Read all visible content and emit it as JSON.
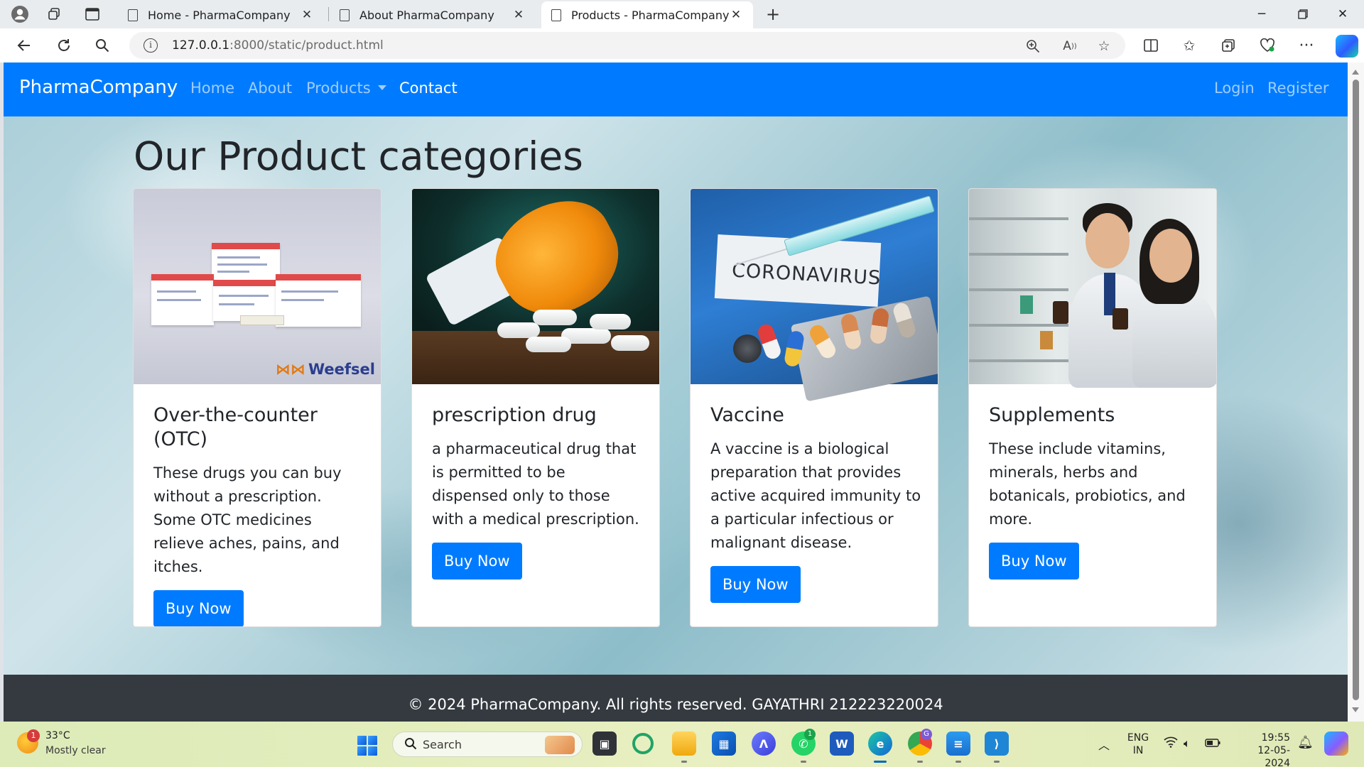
{
  "browser": {
    "tabs": [
      {
        "title": "Home - PharmaCompany"
      },
      {
        "title": "About PharmaCompany"
      },
      {
        "title": "Products - PharmaCompany"
      }
    ],
    "url_host": "127.0.0.1",
    "url_path": ":8000/static/product.html"
  },
  "navbar": {
    "brand": "PharmaCompany",
    "links": [
      "Home",
      "About",
      "Products",
      "Contact"
    ],
    "login": "Login",
    "register": "Register"
  },
  "page": {
    "title": "Our Product categories"
  },
  "products": [
    {
      "title": "Over-the-counter (OTC)",
      "text": "These drugs you can buy without a prescription. Some OTC medicines relieve aches, pains, and itches.",
      "button": "Buy Now",
      "image_brand": "Weefsel"
    },
    {
      "title": "prescription drug",
      "text": "a pharmaceutical drug that is permitted to be dispensed only to those with a medical prescription.",
      "button": "Buy Now"
    },
    {
      "title": "Vaccine",
      "text": "A vaccine is a biological preparation that provides active acquired immunity to a particular infectious or malignant disease.",
      "button": "Buy Now",
      "image_text": "CORONAVIRUS"
    },
    {
      "title": "Supplements",
      "text": "These include vitamins, minerals, herbs and botanicals, probiotics, and more.",
      "button": "Buy Now"
    }
  ],
  "footer": {
    "text": "© 2024 PharmaCompany. All rights reserved. GAYATHRI 212223220024"
  },
  "taskbar": {
    "weather_temp": "33°C",
    "weather_desc": "Mostly clear",
    "weather_badge": "1",
    "search_placeholder": "Search",
    "whatsapp_badge": "1",
    "lang_top": "ENG",
    "lang_bottom": "IN",
    "time": "19:55",
    "date": "12-05-2024"
  },
  "colors": {
    "navbar": "#007bff",
    "button": "#007bff",
    "footer": "#343a40"
  }
}
